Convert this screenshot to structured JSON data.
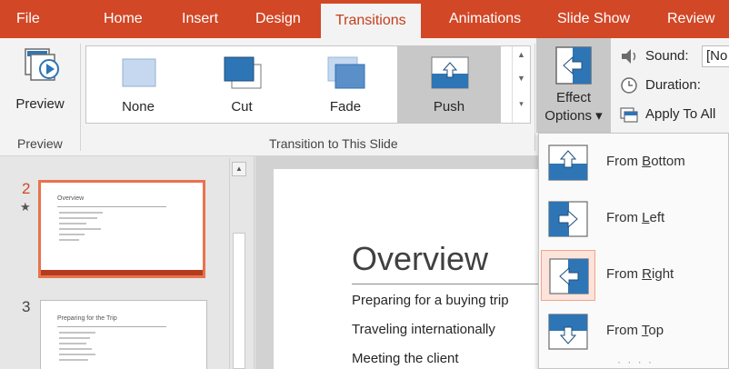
{
  "colors": {
    "accent": "#d24726",
    "ribbon_bg": "#f3f3f3",
    "selected_bg": "#c8c8c8",
    "icon_blue": "#2e75b6"
  },
  "menu_tabs": [
    {
      "label": "File"
    },
    {
      "label": "Home"
    },
    {
      "label": "Insert"
    },
    {
      "label": "Design"
    },
    {
      "label": "Transitions",
      "active": true
    },
    {
      "label": "Animations"
    },
    {
      "label": "Slide Show"
    },
    {
      "label": "Review"
    }
  ],
  "ribbon": {
    "preview_label": "Preview",
    "preview_group_label": "Preview",
    "transitions_group_label": "Transition to This Slide",
    "gallery": [
      {
        "label": "None",
        "icon": "none-transition-icon"
      },
      {
        "label": "Cut",
        "icon": "cut-transition-icon"
      },
      {
        "label": "Fade",
        "icon": "fade-transition-icon"
      },
      {
        "label": "Push",
        "icon": "push-transition-icon",
        "selected": true
      }
    ],
    "effect_options_line1": "Effect",
    "effect_options_line2": "Options ▾",
    "sound_label": "Sound:",
    "sound_value": "[No",
    "duration_label": "Duration:",
    "apply_all_label": "Apply To All"
  },
  "slides": [
    {
      "number": "2",
      "star": "★",
      "title": "Overview",
      "selected": true
    },
    {
      "number": "3",
      "title": "Preparing for the Trip",
      "selected": false
    }
  ],
  "slide_editor": {
    "title": "Overview",
    "bullets": [
      "Preparing for a buying trip",
      "Traveling internationally",
      "Meeting the client"
    ]
  },
  "effect_options_menu": [
    {
      "label": "From Bottom",
      "accel": "B",
      "icon": "arrow-up-icon"
    },
    {
      "label": "From Left",
      "accel": "L",
      "icon": "arrow-right-icon"
    },
    {
      "label": "From Right",
      "accel": "R",
      "icon": "arrow-left-icon",
      "checked": true
    },
    {
      "label": "From Top",
      "accel": "T",
      "icon": "arrow-down-icon"
    }
  ],
  "menu_more": "· · · ·"
}
